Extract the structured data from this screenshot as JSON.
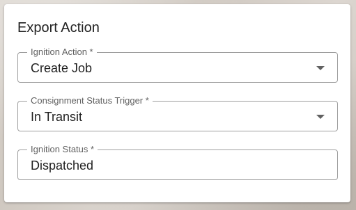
{
  "card": {
    "title": "Export Action"
  },
  "fields": [
    {
      "label": "Ignition Action *",
      "value": "Create Job",
      "type": "select"
    },
    {
      "label": "Consignment Status Trigger *",
      "value": "In Transit",
      "type": "select"
    },
    {
      "label": "Ignition Status *",
      "value": "Dispatched",
      "type": "text"
    }
  ],
  "icons": {
    "dropdown": "chevron-down-icon"
  }
}
